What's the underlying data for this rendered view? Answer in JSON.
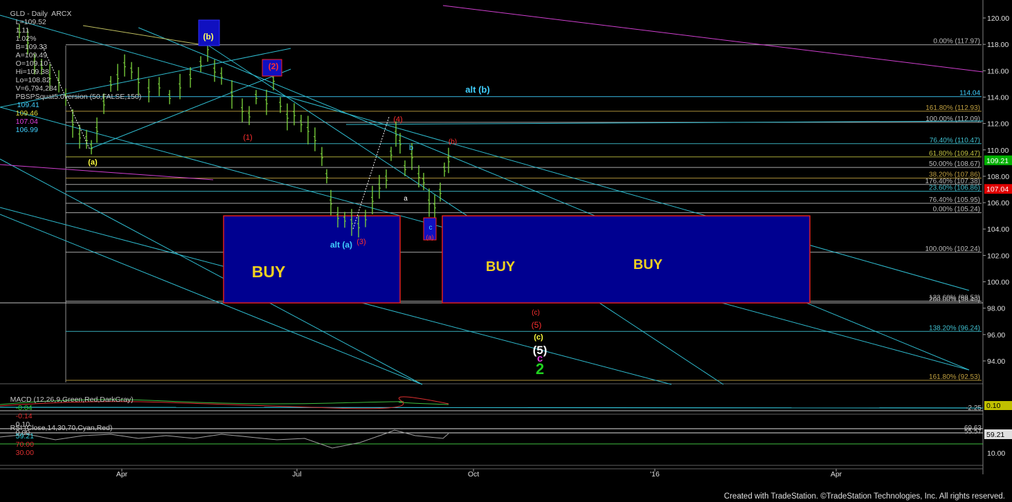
{
  "header": {
    "symbol": "GLD - Daily  ARCX",
    "last": "L=109.52",
    "change": "1.11",
    "change_pct": "1.02%",
    "bid": "B=109.33",
    "ask": "A=109.49",
    "open": "O=109.10",
    "high": "Hi=109.38",
    "low": "Lo=108.82",
    "volume": "V=6,794,284",
    "study": "PBSPSquat5.0version (50,FALSE,150)",
    "study_values": [
      "109.41",
      "109.46",
      "107.04",
      "106.99"
    ]
  },
  "macd": {
    "title": "MACD (12,26,9,Green,Red,DarkGray)",
    "values": [
      "-0.04",
      "-0.14",
      "0.10",
      "0.00"
    ],
    "right_values": [
      "-2.25",
      "0.10"
    ]
  },
  "rsi": {
    "title": "RSI (Close,14,30,70,Cyan,Red)",
    "values": [
      "59.21",
      "70.00",
      "30.00"
    ],
    "right_values": [
      "69.63",
      "55.57",
      "59.21",
      "10.00"
    ]
  },
  "footer": "Created with TradeStation. ©TradeStation Technologies, Inc. All rights reserved.",
  "colors": {
    "background": "#000000",
    "bars": "#7fd93f",
    "channel": "#2fbcd0",
    "magenta": "#d040d0",
    "buy_box": "#000090",
    "buy_border": "#e02020",
    "label_yellow": "#ffff00",
    "label_red": "#ff2020",
    "label_cyan": "#40d0ff",
    "label_green": "#20d020"
  },
  "chart_data": {
    "type": "candlestick",
    "y_axis": {
      "min": 92,
      "max": 121,
      "ticks": [
        "120.00",
        "118.00",
        "116.00",
        "114.00",
        "112.00",
        "110.00",
        "108.00",
        "106.00",
        "104.00",
        "102.00",
        "100.00",
        "98.00",
        "96.00",
        "94.00"
      ]
    },
    "x_axis": {
      "ticks": [
        "Apr",
        "Jul",
        "Oct",
        "'16",
        "Apr"
      ]
    },
    "price_tags": [
      {
        "value": "109.21",
        "price": 109.21,
        "color": "#00b000"
      },
      {
        "value": "107.04",
        "price": 107.04,
        "color": "#e00000"
      }
    ],
    "fib_levels": [
      {
        "label": "0.00% (117.97)",
        "price": 117.97,
        "color": "#bbbbbb"
      },
      {
        "label": "114.04",
        "price": 114.04,
        "color": "#40d0ff"
      },
      {
        "label": "161.80% (112.93)",
        "price": 112.93,
        "color": "#c0a040"
      },
      {
        "label": "100.00% (112.09)",
        "price": 112.09,
        "color": "#bbbbbb"
      },
      {
        "label": "76.40% (110.47)",
        "price": 110.47,
        "color": "#40c0d0"
      },
      {
        "label": "61.80% (109.47)",
        "price": 109.47,
        "color": "#c0c040"
      },
      {
        "label": "50.00% (108.67)",
        "price": 108.67,
        "color": "#bbbbbb"
      },
      {
        "label": "38.20% (107.86)",
        "price": 107.86,
        "color": "#c0a040"
      },
      {
        "label": "176.40% (107.38)",
        "price": 107.38,
        "color": "#bbbbbb"
      },
      {
        "label": "23.60% (106.86)",
        "price": 106.86,
        "color": "#40c0d0"
      },
      {
        "label": "76.40% (105.95)",
        "price": 105.95,
        "color": "#bbbbbb"
      },
      {
        "label": "0.00% (105.24)",
        "price": 105.24,
        "color": "#bbbbbb"
      },
      {
        "label": "100.00% (102.24)",
        "price": 102.24,
        "color": "#bbbbbb"
      },
      {
        "label": "123.60% (98.53)",
        "price": 98.53,
        "color": "#bbbbbb"
      },
      {
        "label": "200.00% (98.40)",
        "price": 98.4,
        "color": "#bbbbbb"
      },
      {
        "label": "138.20% (96.24)",
        "price": 96.24,
        "color": "#40c0d0"
      },
      {
        "label": "161.80% (92.53)",
        "price": 92.53,
        "color": "#c0a040"
      }
    ],
    "buy_boxes": [
      {
        "label": "BUY",
        "price_top": 105.0,
        "price_bottom": 98.4
      },
      {
        "label": "BUY",
        "price_top": 105.0,
        "price_bottom": 98.4
      },
      {
        "label": "BUY",
        "price_top": 105.0,
        "price_bottom": 98.4
      }
    ],
    "wave_labels": [
      {
        "text": "(b)",
        "color": "yellow"
      },
      {
        "text": "(2)",
        "color": "red"
      },
      {
        "text": "alt (b)",
        "color": "cyan"
      },
      {
        "text": "(4)",
        "color": "red"
      },
      {
        "text": "(b)",
        "color": "red"
      },
      {
        "text": "b",
        "color": "cyan"
      },
      {
        "text": "a",
        "color": "white"
      },
      {
        "text": "(1)",
        "color": "red"
      },
      {
        "text": "(a)",
        "color": "yellow"
      },
      {
        "text": "alt (a)",
        "color": "cyan"
      },
      {
        "text": "(3)",
        "color": "red"
      },
      {
        "text": "c",
        "color": "cyan"
      },
      {
        "text": "(a)",
        "color": "red"
      },
      {
        "text": "(c)",
        "color": "red"
      },
      {
        "text": "(5)",
        "color": "red"
      },
      {
        "text": "(c)",
        "color": "yellow"
      },
      {
        "text": "(5)",
        "color": "white"
      },
      {
        "text": "c",
        "color": "magenta"
      },
      {
        "text": "2",
        "color": "green"
      }
    ],
    "macd_scale": [
      "0.10",
      "-2.25"
    ],
    "rsi_scale": [
      "59.21",
      "10.00"
    ]
  }
}
